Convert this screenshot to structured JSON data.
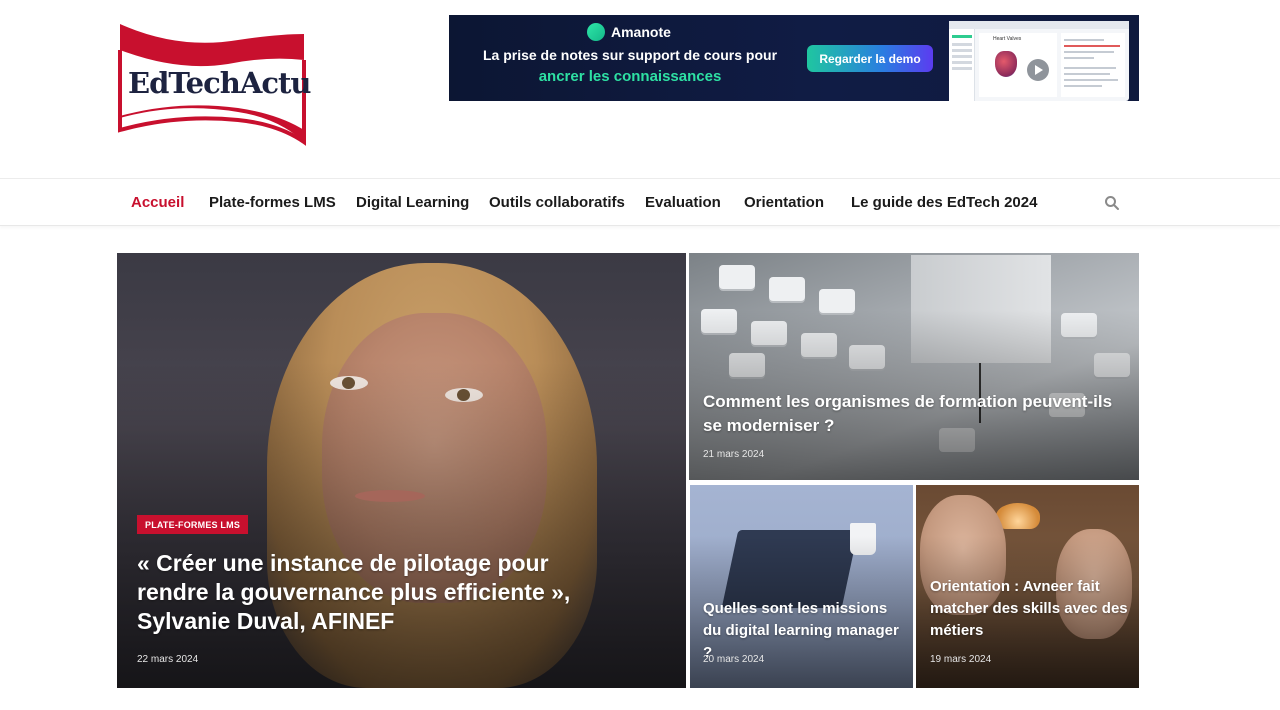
{
  "site": {
    "logo_text": "EdTechActu"
  },
  "ad": {
    "brand": "Amanote",
    "line1": "La prise de notes sur support de cours pour",
    "line2": "ancrer les connaissances",
    "cta": "Regarder la demo",
    "screen_title": "Heart Valves"
  },
  "nav": {
    "items": [
      {
        "label": "Accueil",
        "active": true
      },
      {
        "label": "Plate-formes LMS",
        "active": false
      },
      {
        "label": "Digital Learning",
        "active": false
      },
      {
        "label": "Outils collaboratifs",
        "active": false
      },
      {
        "label": "Evaluation",
        "active": false
      },
      {
        "label": "Orientation",
        "active": false
      },
      {
        "label": "Le guide des EdTech 2024",
        "active": false
      }
    ],
    "search_icon": "search-icon"
  },
  "articles": {
    "featured": {
      "category": "PLATE-FORMES LMS",
      "title": "« Créer une instance de pilotage pour rendre la gouvernance plus efficiente », Sylvanie Duval, AFINEF",
      "date": "22 mars 2024"
    },
    "top_right": {
      "title": "Comment les organismes de formation peuvent-ils se moderniser ?",
      "date": "21 mars 2024"
    },
    "bottom_left": {
      "title": "Quelles sont les missions du digital learning manager ?",
      "date": "20 mars 2024"
    },
    "bottom_right": {
      "title": "Orientation : Avneer fait matcher des skills avec des métiers",
      "date": "19 mars 2024"
    }
  },
  "colors": {
    "accent": "#c8102e",
    "nav_text": "#1b1b1b",
    "logo_text": "#1d2340",
    "ad_background": "#0c1633",
    "ad_highlight": "#2ee0a3"
  }
}
